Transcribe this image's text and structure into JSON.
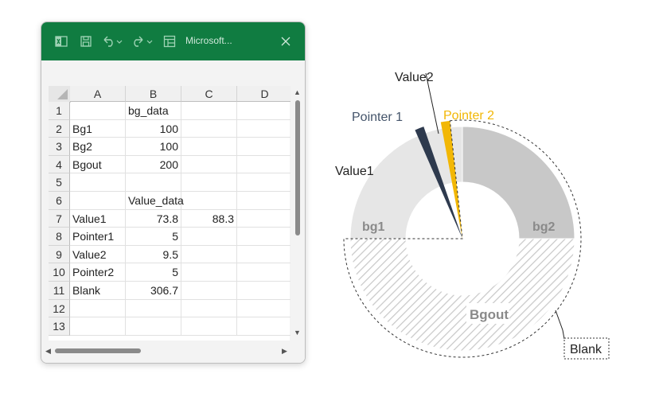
{
  "window": {
    "title": "Microsoft...",
    "titlebar_color": "#107c41",
    "icons": [
      "excel-icon",
      "save-icon",
      "undo-icon",
      "redo-icon",
      "form-icon",
      "close-icon"
    ]
  },
  "sheet": {
    "columns": [
      "A",
      "B",
      "C",
      "D"
    ],
    "rows": [
      "1",
      "2",
      "3",
      "4",
      "5",
      "6",
      "7",
      "8",
      "9",
      "10",
      "11",
      "12",
      "13"
    ],
    "cells": [
      [
        "",
        "bg_data",
        "",
        ""
      ],
      [
        "Bg1",
        "100",
        "",
        ""
      ],
      [
        "Bg2",
        "100",
        "",
        ""
      ],
      [
        "Bgout",
        "200",
        "",
        ""
      ],
      [
        "",
        "",
        "",
        ""
      ],
      [
        "",
        "Value_data",
        "",
        ""
      ],
      [
        "Value1",
        "73.8",
        "88.3",
        ""
      ],
      [
        "Pointer1",
        "5",
        "",
        ""
      ],
      [
        "Value2",
        "9.5",
        "",
        ""
      ],
      [
        "Pointer2",
        "5",
        "",
        ""
      ],
      [
        "Blank",
        "306.7",
        "",
        ""
      ],
      [
        "",
        "",
        "",
        ""
      ],
      [
        "",
        "",
        "",
        ""
      ]
    ]
  },
  "chart_data": {
    "type": "pie",
    "rings": [
      {
        "name": "bg_data",
        "categories": [
          "bg1",
          "bg2",
          "Bgout"
        ],
        "values": [
          100,
          100,
          200
        ],
        "colors": [
          "#e6e6e6",
          "#c8c8c8",
          "hatched"
        ]
      },
      {
        "name": "Value_data",
        "categories": [
          "Value1",
          "Pointer1",
          "Value2",
          "Pointer2",
          "Blank"
        ],
        "values": [
          73.8,
          5,
          9.5,
          5,
          306.7
        ],
        "colors": [
          "transparent",
          "#2e3a4e",
          "transparent",
          "#f2b705",
          "transparent"
        ]
      }
    ],
    "labels": {
      "bg1": "bg1",
      "bg2": "bg2",
      "bgout": "Bgout",
      "value1": "Value1",
      "pointer1": "Pointer 1",
      "value2": "Value2",
      "pointer2": "Pointer 2",
      "blank": "Blank"
    },
    "label_colors": {
      "pointer1": "#44546a",
      "pointer2": "#f2b705",
      "bg": "#8a8a8a",
      "text": "#222222"
    }
  }
}
